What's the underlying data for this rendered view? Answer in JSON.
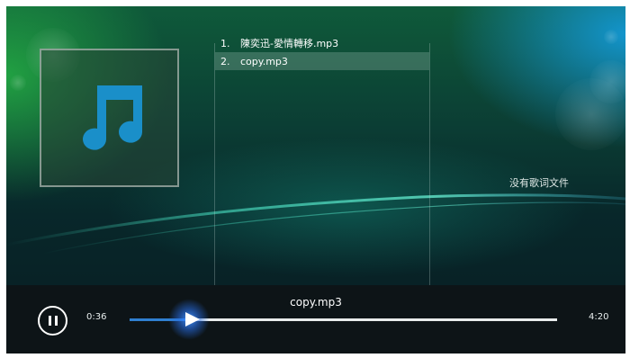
{
  "playlist": {
    "tracks": [
      {
        "number": "1.",
        "title": "陳奕迅-愛情轉移.mp3",
        "selected": false
      },
      {
        "number": "2.",
        "title": "copy.mp3",
        "selected": true
      }
    ]
  },
  "lyrics": {
    "empty_text": "没有歌词文件"
  },
  "player": {
    "now_playing": "copy.mp3",
    "elapsed": "0:36",
    "duration": "4:20",
    "progress": 0.138,
    "state": "playing"
  },
  "icons": {
    "album_art": "music-note-icon",
    "control": "pause-icon",
    "seek": "play-triangle-icon"
  },
  "colors": {
    "accent": "#2f7fd0",
    "note": "#1a8fc9",
    "control_bar": "#0d1417"
  }
}
